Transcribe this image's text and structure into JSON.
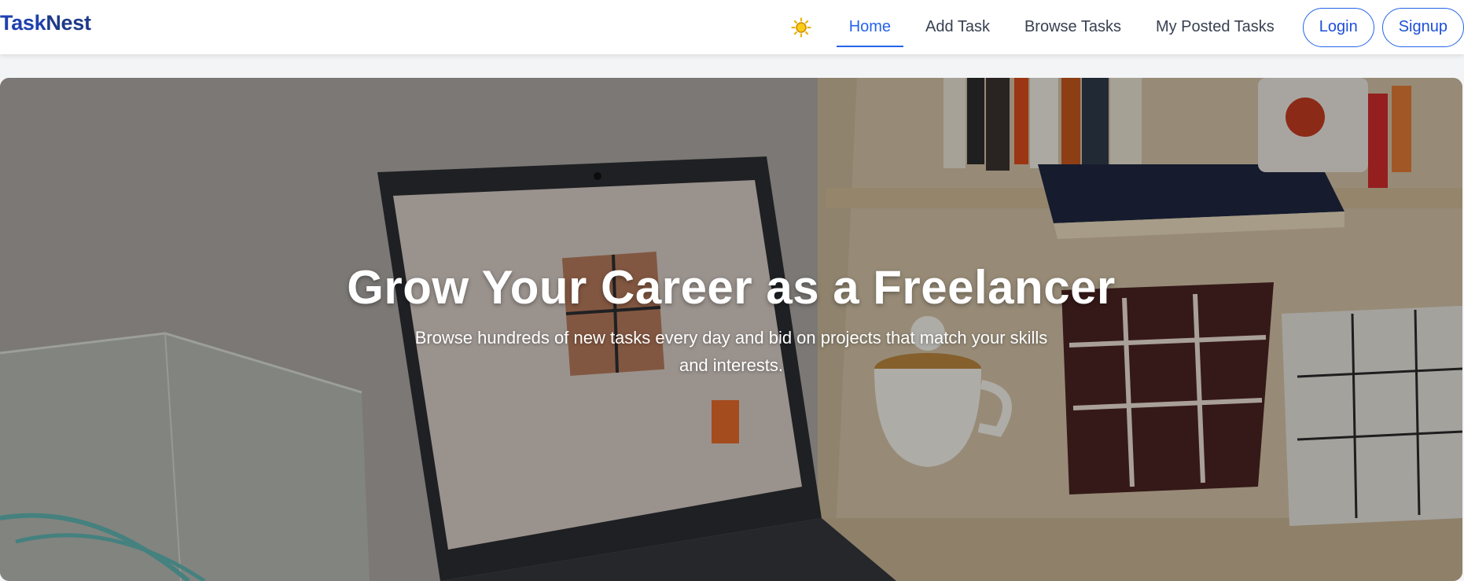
{
  "brand": {
    "name_part1": "Task",
    "name_part2": "Nest"
  },
  "theme_toggle": {
    "icon": "sun-icon",
    "color": "#eab308"
  },
  "nav": {
    "links": [
      {
        "label": "Home",
        "active": true
      },
      {
        "label": "Add Task",
        "active": false
      },
      {
        "label": "Browse Tasks",
        "active": false
      },
      {
        "label": "My Posted Tasks",
        "active": false
      }
    ],
    "login_label": "Login",
    "signup_label": "Signup"
  },
  "hero": {
    "title": "Grow Your Career as a Freelancer",
    "subtitle": "Browse hundreds of new tasks every day and bid on projects that match your skills and interests."
  },
  "colors": {
    "accent": "#2563eb",
    "brand": "#1e40af"
  }
}
